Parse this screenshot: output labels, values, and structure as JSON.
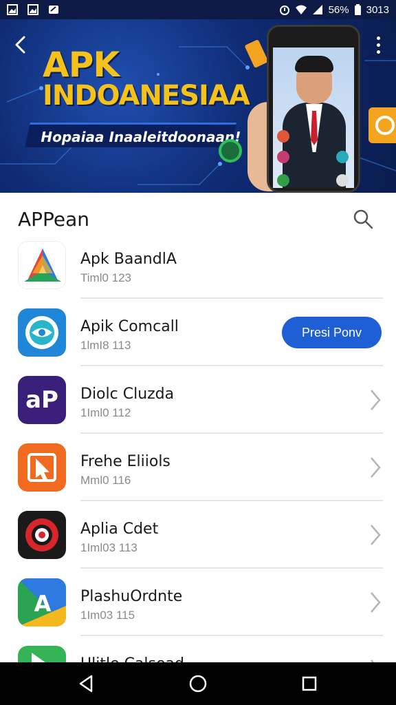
{
  "status_bar": {
    "battery": "56%",
    "time": "3013",
    "icons": [
      "image-icon",
      "image-icon",
      "message-icon",
      "alarm-icon",
      "wifi-icon",
      "signal-icon",
      "battery-icon"
    ]
  },
  "banner": {
    "title_line1": "APK",
    "title_line2": "INDOANESIAA",
    "subtitle": "Hopaiaa Inaaleitdoonaan!",
    "icons": [
      "back-icon",
      "more-vert-icon"
    ]
  },
  "list": {
    "title": "APPean",
    "search_icon": "search-icon",
    "items": [
      {
        "name": "Apk BaandlA",
        "meta": "Timl0 123",
        "icon": "multicolor-a-logo",
        "trailing": "none"
      },
      {
        "name": "Apik Comcall",
        "meta": "1lmI8 113",
        "icon": "blue-swirl-logo",
        "trailing": "button",
        "button_label": "Presi Ponv"
      },
      {
        "name": "Diolc Cluzda",
        "meta": "1Iml0 112",
        "icon": "purple-ap-logo",
        "trailing": "chevron"
      },
      {
        "name": "Frehe Eliiols",
        "meta": "Mml0 116",
        "icon": "orange-cursor-logo",
        "trailing": "chevron"
      },
      {
        "name": "Aplia Cdet",
        "meta": "1Iml03 113",
        "icon": "red-target-logo",
        "trailing": "chevron"
      },
      {
        "name": "PlashuOrdnte",
        "meta": "1Im03 115",
        "icon": "green-a-logo",
        "trailing": "chevron"
      },
      {
        "name": "Ulitle Calsead",
        "meta": "",
        "icon": "green-play-logo",
        "trailing": "chevron"
      }
    ]
  },
  "nav_bar": {
    "buttons": [
      "back-icon",
      "home-icon",
      "recents-icon"
    ]
  },
  "colors": {
    "accent": "#1f5fd6",
    "banner_bg": "#0f2b73",
    "banner_title": "#f4c21a"
  }
}
